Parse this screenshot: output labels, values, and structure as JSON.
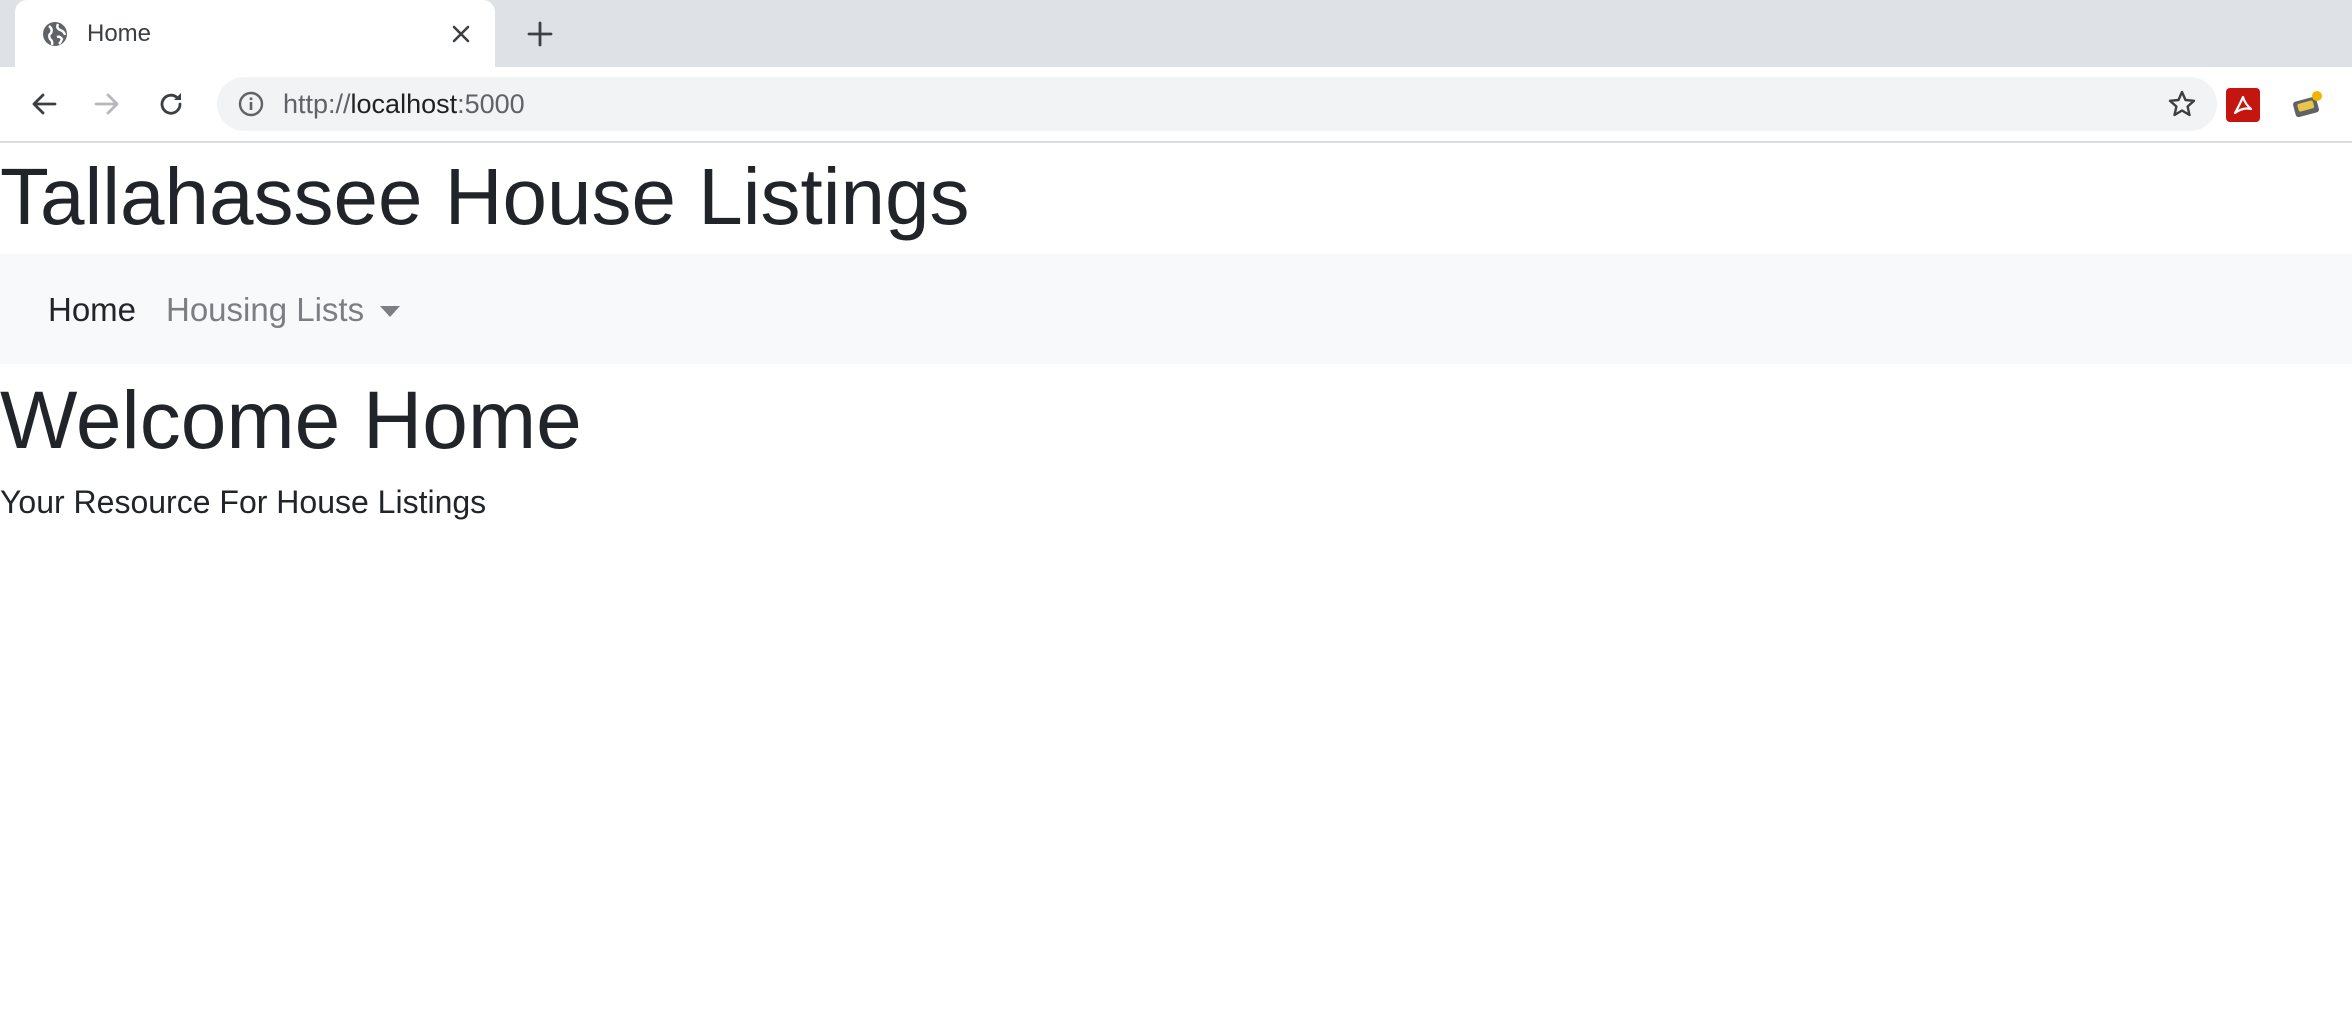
{
  "browser": {
    "tab": {
      "title": "Home",
      "favicon": "globe-icon",
      "close_icon": "close-icon"
    },
    "new_tab_icon": "plus-icon",
    "toolbar": {
      "back_icon": "arrow-left-icon",
      "forward_icon": "arrow-right-icon",
      "reload_icon": "reload-icon",
      "info_icon": "info-icon",
      "url_scheme": "http://",
      "url_host": "localhost",
      "url_port": ":5000",
      "bookmark_icon": "star-icon",
      "extensions": [
        "acrobat-pdf-icon",
        "extension-icon"
      ]
    }
  },
  "page": {
    "site_title": "Tallahassee House Listings",
    "navbar": {
      "home_label": "Home",
      "dropdown_label": "Housing Lists"
    },
    "heading": "Welcome Home",
    "subtitle": "Your Resource For House Listings"
  },
  "colors": {
    "tabstrip_bg": "#dee1e6",
    "omnibox_bg": "#f1f3f4",
    "navbar_bg": "#f8f9fa",
    "text_dark": "#212529",
    "nav_muted": "#7b7f83",
    "pdf_red": "#c4160e"
  }
}
